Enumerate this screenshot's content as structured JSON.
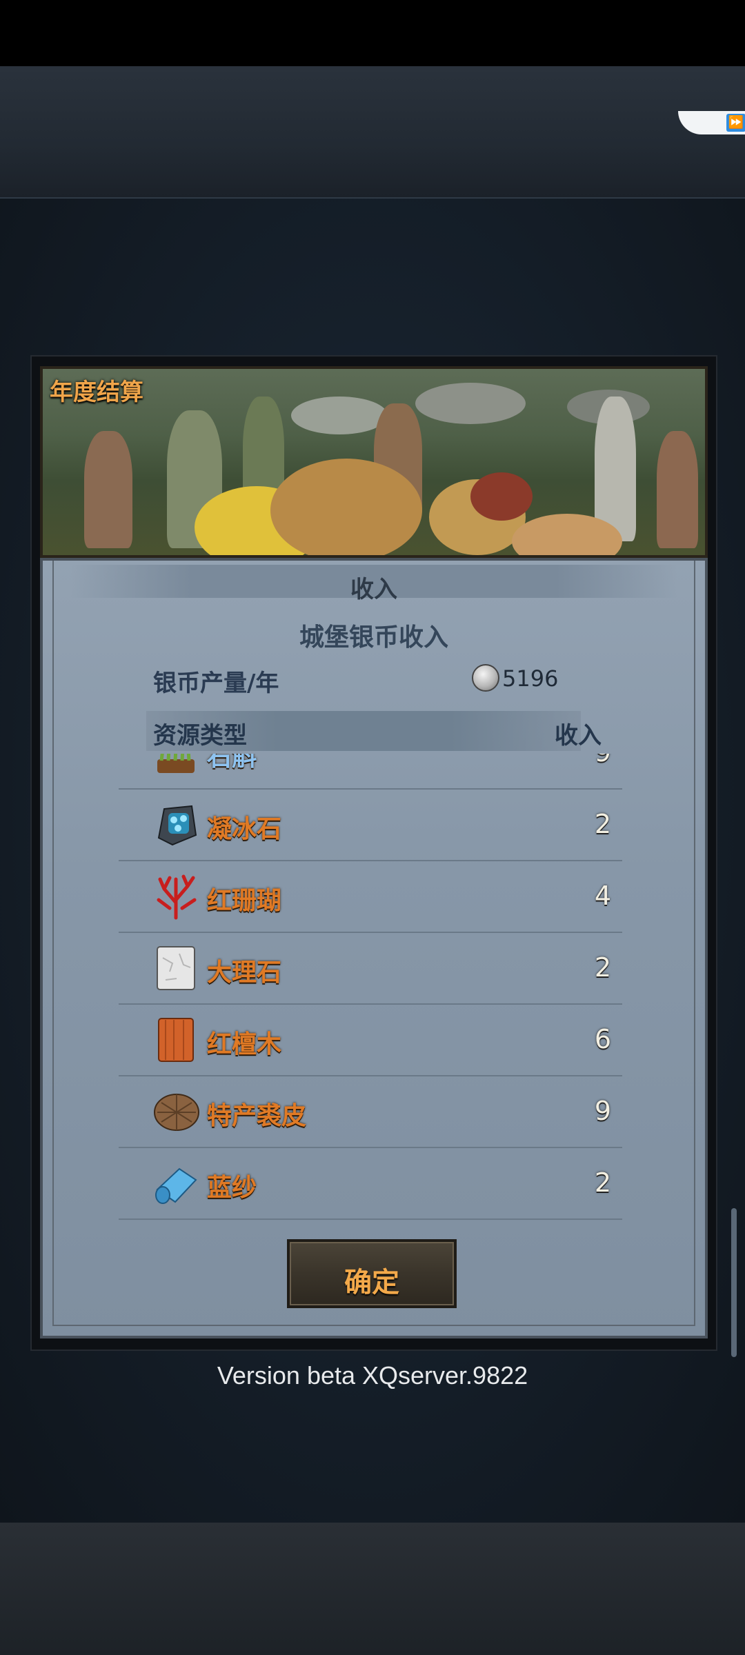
{
  "banner": {
    "title": "年度结算"
  },
  "panel": {
    "section_title": "收入",
    "subtitle": "城堡银币收入",
    "silver_label": "银币产量/年",
    "silver_value": "5196",
    "column_type": "资源类型",
    "column_income": "收入"
  },
  "resources": [
    {
      "name": "石斛",
      "qty": "9",
      "icon": "dendrobium-icon"
    },
    {
      "name": "凝冰石",
      "qty": "2",
      "icon": "frozen-stone-icon"
    },
    {
      "name": "红珊瑚",
      "qty": "4",
      "icon": "red-coral-icon"
    },
    {
      "name": "大理石",
      "qty": "2",
      "icon": "marble-icon"
    },
    {
      "name": "红檀木",
      "qty": "6",
      "icon": "red-sandalwood-icon"
    },
    {
      "name": "特产裘皮",
      "qty": "9",
      "icon": "fur-icon"
    },
    {
      "name": "蓝纱",
      "qty": "2",
      "icon": "blue-gauze-icon"
    }
  ],
  "confirm_label": "确定",
  "version": "Version beta XQserver.9822"
}
